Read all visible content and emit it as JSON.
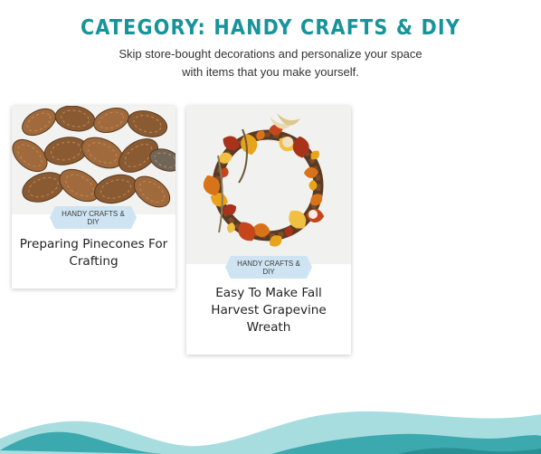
{
  "page": {
    "title": "CATEGORY: HANDY CRAFTS & DIY",
    "description": "Skip store-bought decorations and personalize your space with items that you make yourself."
  },
  "posts": [
    {
      "title": "Preparing Pinecones For Crafting",
      "category": "HANDY CRAFTS & DIY",
      "image": "pinecones-photo"
    },
    {
      "title": "Easy To Make Fall Harvest Grapevine Wreath",
      "category": "HANDY CRAFTS & DIY",
      "image": "fall-wreath-photo"
    }
  ],
  "colors": {
    "accent": "#17949a",
    "badge_bg": "#cfe4f2",
    "wave_light": "#a8dde0",
    "wave_dark": "#3ba9ad"
  }
}
